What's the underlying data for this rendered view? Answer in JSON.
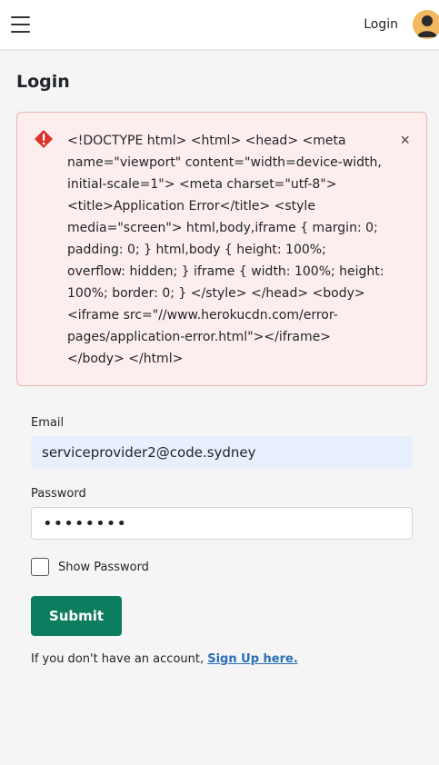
{
  "header": {
    "menu_icon": "hamburger-icon",
    "login_label": "Login",
    "avatar_icon": "user-avatar-icon",
    "avatar_color": "#f2b960"
  },
  "page": {
    "title": "Login"
  },
  "alert": {
    "icon": "error-diamond-icon",
    "message": "<!DOCTYPE html> <html> <head> <meta name=\"viewport\" content=\"width=device-width, initial-scale=1\"> <meta charset=\"utf-8\"> <title>Application Error</title> <style media=\"screen\"> html,body,iframe { margin: 0; padding: 0; } html,body { height: 100%; overflow: hidden; } iframe { width: 100%; height: 100%; border: 0; } </style> </head> <body> <iframe src=\"//www.herokucdn.com/error-pages/application-error.html\"></iframe> </body> </html>",
    "close_label": "×",
    "colors": {
      "background": "#fdeeee",
      "border": "#e8b6b6",
      "icon": "#d9342b"
    }
  },
  "form": {
    "email_label": "Email",
    "email_value": "serviceprovider2@code.sydney",
    "password_label": "Password",
    "password_value": "••••••••",
    "show_password_label": "Show Password",
    "show_password_checked": false,
    "submit_label": "Submit",
    "submit_color": "#0d7d5f",
    "signup_prompt": "If you don't have an account, ",
    "signup_link": "Sign Up here."
  }
}
